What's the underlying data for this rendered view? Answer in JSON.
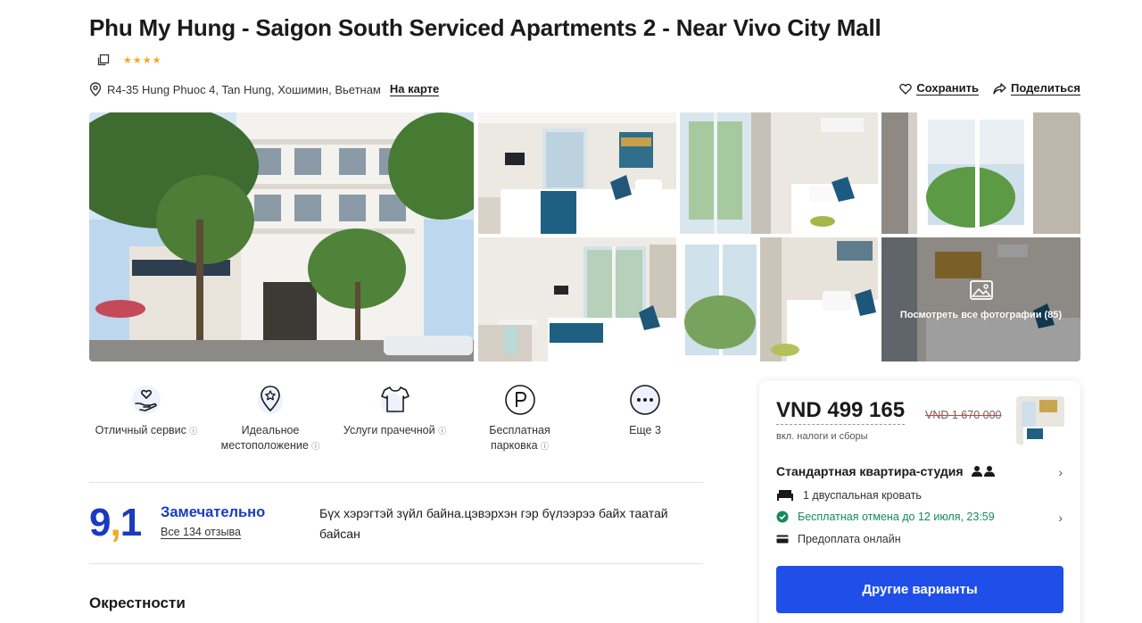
{
  "hotel": {
    "title": "Phu My Hung - Saigon South Serviced Apartments 2 - Near Vivo City Mall",
    "stars": "★★★★",
    "address": "R4-35 Hung Phuoc 4, Tan Hung, Хошимин, Вьетнам",
    "map_link": "На карте",
    "save_label": "Сохранить",
    "share_label": "Поделиться"
  },
  "gallery": {
    "view_all": "Посмотреть все фотографии (85)"
  },
  "amenities": [
    {
      "label": "Отличный сервис",
      "icon": "heart-hand-icon"
    },
    {
      "label": "Идеальное местоположение",
      "icon": "location-star-icon"
    },
    {
      "label": "Услуги прачечной",
      "icon": "tshirt-icon"
    },
    {
      "label": "Бесплатная парковка",
      "icon": "parking-icon"
    },
    {
      "label": "Еще 3",
      "icon": "more-icon"
    }
  ],
  "rating": {
    "score_int": "9",
    "score_comma": ",",
    "score_dec": "1",
    "word": "Замечательно",
    "reviews": "Все 134 отзыва",
    "review_text": "Бүх хэрэгтэй зүйл байна.цэвэрхэн гэр бүлээрээ байх таатай байсан"
  },
  "section": {
    "title": "Окрестности"
  },
  "booking": {
    "price": "VND 499 165",
    "old_price": "VND 1 670 000",
    "tax_note": "вкл. налоги и сборы",
    "room_name": "Стандартная квартира-студия",
    "bed": "1 двуспальная кровать",
    "cancel": "Бесплатная отмена до 12 июля, 23:59",
    "prepay": "Предоплата онлайн",
    "cta": "Другие варианты"
  },
  "colors": {
    "brand_blue": "#1f4fe8",
    "rating_blue": "#1a3bbf",
    "star_orange": "#f6a623",
    "green": "#158a5c"
  }
}
